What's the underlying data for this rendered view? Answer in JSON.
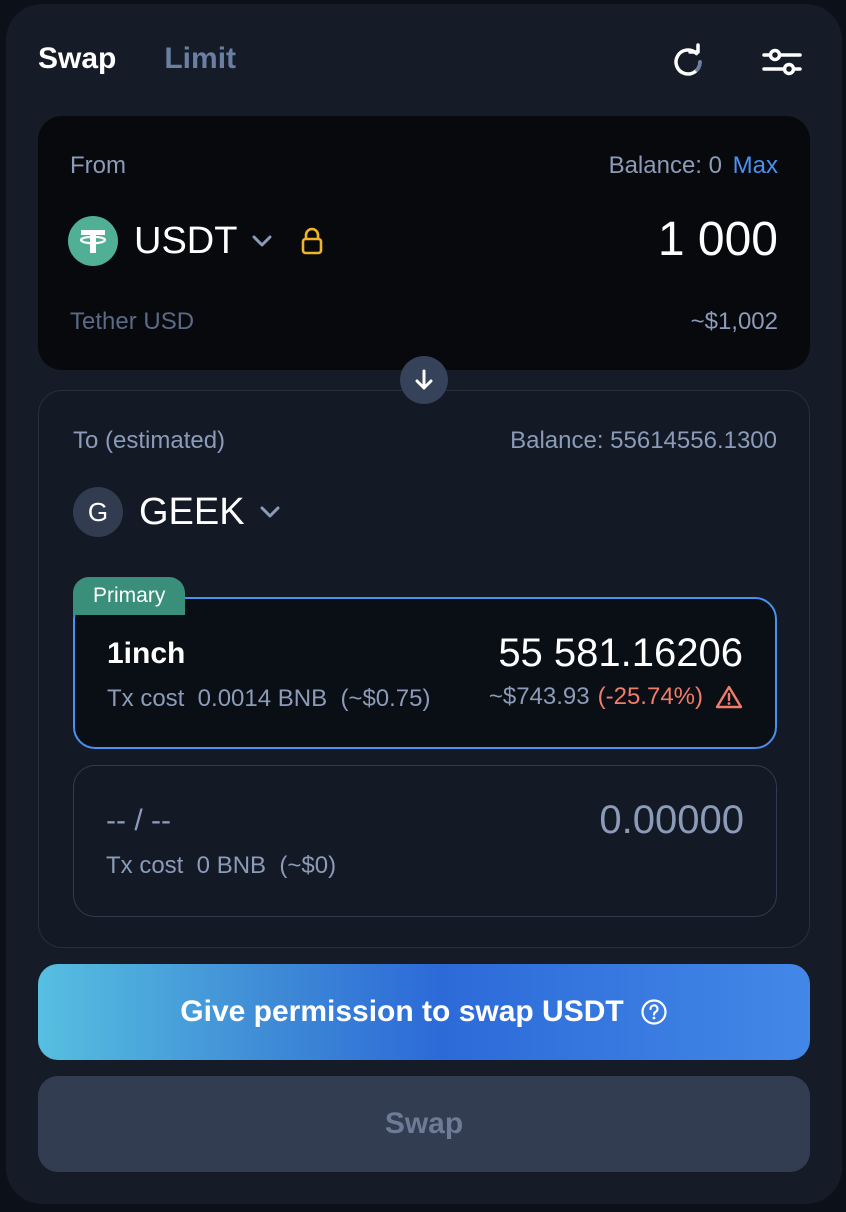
{
  "tabs": [
    {
      "label": "Swap",
      "active": true
    },
    {
      "label": "Limit",
      "active": false
    }
  ],
  "header_icons": {
    "refresh": "refresh-icon",
    "settings": "sliders-icon"
  },
  "from": {
    "label": "From",
    "balance_label": "Balance: 0",
    "max_label": "Max",
    "token_symbol": "USDT",
    "token_icon": "tether-icon",
    "token_full_name": "Tether USD",
    "amount": "1 000",
    "usd_value": "~$1,002"
  },
  "to": {
    "label": "To (estimated)",
    "balance_label": "Balance: 55614556.1300",
    "token_symbol": "GEEK",
    "token_letter": "G",
    "routes": [
      {
        "badge": "Primary",
        "name": "1inch",
        "amount": "55 581.16206",
        "tx_cost": "Tx cost  0.0014 BNB  (~$0.75)",
        "usd_value": "~$743.93",
        "price_impact": "(-25.74%)"
      },
      {
        "name": "-- / --",
        "amount": "0.00000",
        "tx_cost": "Tx cost  0 BNB  (~$0)"
      }
    ]
  },
  "buttons": {
    "permission_label": "Give permission to swap USDT",
    "swap_label": "Swap"
  },
  "colors": {
    "accent": "#4a90f0",
    "primary_badge": "#3a8f7b",
    "negative": "#f07c6a",
    "lock": "#f0b429",
    "usdt": "#50af95"
  }
}
